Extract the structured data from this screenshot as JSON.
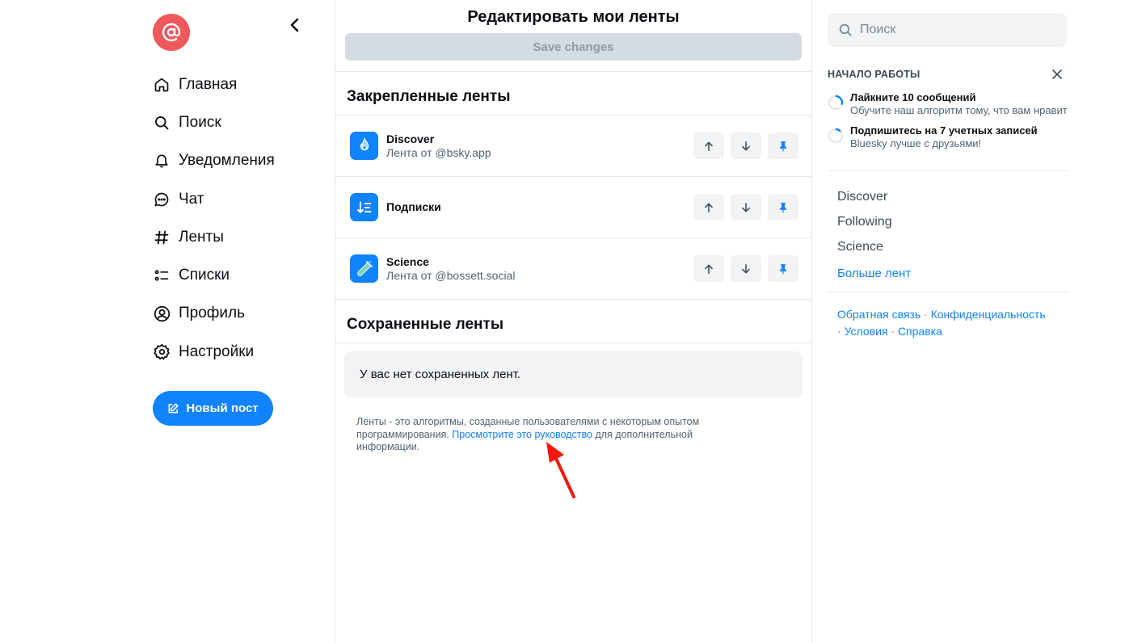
{
  "left_nav": {
    "logo_icon": "at-sign-icon",
    "logo_color": "#f0595c",
    "items": [
      {
        "label": "Главная",
        "icon": "home-icon"
      },
      {
        "label": "Поиск",
        "icon": "search-icon"
      },
      {
        "label": "Уведомления",
        "icon": "bell-icon"
      },
      {
        "label": "Чат",
        "icon": "chat-icon"
      },
      {
        "label": "Ленты",
        "icon": "hash-icon"
      },
      {
        "label": "Списки",
        "icon": "list-icon"
      },
      {
        "label": "Профиль",
        "icon": "profile-icon"
      },
      {
        "label": "Настройки",
        "icon": "gear-icon"
      }
    ],
    "new_post_label": "Новый пост"
  },
  "main": {
    "title": "Редактировать мои ленты",
    "save_label": "Save changes",
    "pinned_title": "Закрепленные ленты",
    "pinned_feeds": [
      {
        "name": "Discover",
        "sub": "Лента от @bsky.app",
        "icon": "flame-icon"
      },
      {
        "name": "Подписки",
        "sub": "",
        "icon": "sort-list-icon"
      },
      {
        "name": "Science",
        "sub": "Лента от @bossett.social",
        "icon": "test-tube-icon"
      }
    ],
    "saved_title": "Сохраненные ленты",
    "empty_saved": "У вас нет сохраненных лент.",
    "info_prefix": "Ленты - это алгоритмы, созданные пользователями с некоторым опытом программирования. ",
    "info_link": "Просмотрите это руководство",
    "info_suffix": " для дополнительной информации."
  },
  "right": {
    "search_placeholder": "Поиск",
    "getting_started_title": "НАЧАЛО РАБОТЫ",
    "tasks": [
      {
        "title": "Лайкните 10 сообщений",
        "sub": "Обучите наш алгоритм тому, что вам нравится",
        "progress": 0.3
      },
      {
        "title": "Подпишитесь на 7 учетных записей",
        "sub": "Bluesky лучше с друзьями!",
        "progress": 0.14
      }
    ],
    "feeds": [
      "Discover",
      "Following",
      "Science"
    ],
    "more_feeds": "Больше лент",
    "footer": {
      "feedback": "Обратная связь",
      "privacy": "Конфиденциальность",
      "terms": "Условия",
      "help": "Справка",
      "separator": " · "
    }
  },
  "accent_color": "#1083fe"
}
